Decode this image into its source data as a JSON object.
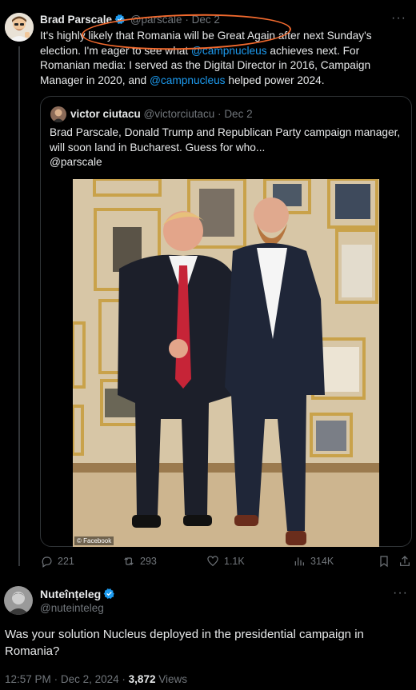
{
  "main_post": {
    "author_name": "Brad Parscale",
    "handle": "@parscale",
    "date": "Dec 2",
    "text_parts": {
      "a": "It's highly likely that Romania will be Great Again after next Sunday's election. I'm eager to see what ",
      "link1": "@campnucleus",
      "b": " achieves next. For Romanian media: I served as the Digital Director in 2016, Campaign Manager in 2020, and ",
      "link2": "@campnucleus",
      "c": " helped power 2024."
    }
  },
  "quoted_post": {
    "author_name": "victor ciutacu",
    "handle": "@victorciutacu",
    "date": "Dec 2",
    "text": "Brad Parscale, Donald Trump and Republican Party campaign manager, will soon land in Bucharest. Guess for who...",
    "mention": "@parscale",
    "image_credit": "© Facebook"
  },
  "actions": {
    "replies": "221",
    "reposts": "293",
    "likes": "1.1K",
    "views": "314K"
  },
  "reply": {
    "author_name": "Nuteînțeleg",
    "handle": "@nuteinteleg",
    "text": "Was your solution Nucleus deployed in the presidential campaign in Romania?",
    "time": "12:57 PM",
    "date": "Dec 2, 2024",
    "views_count": "3,872",
    "views_label": "Views"
  },
  "colors": {
    "background": "#000000",
    "link": "#1d9bf0",
    "muted": "#71767b",
    "annotation_oval": "#f26a2e"
  }
}
